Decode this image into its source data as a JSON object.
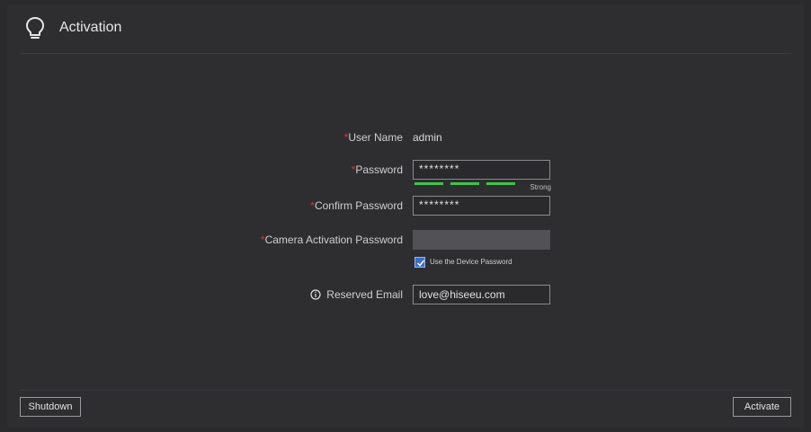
{
  "header": {
    "title": "Activation",
    "icon": "lightbulb-icon"
  },
  "form": {
    "user_name": {
      "label": "User Name",
      "required_marker": "*",
      "value": "admin"
    },
    "password": {
      "label": "Password",
      "required_marker": "*",
      "value": "********",
      "strength_label": "Strong",
      "strength_color": "#3fc24a",
      "strength_level": 3,
      "strength_max": 3
    },
    "confirm_password": {
      "label": "Confirm Password",
      "required_marker": "*",
      "value": "********"
    },
    "camera_activation_password": {
      "label": "Camera Activation Password",
      "required_marker": "*",
      "value": ""
    },
    "use_device_password": {
      "label": "Use the Device Password",
      "checked": true
    },
    "reserved_email": {
      "label": "Reserved Email",
      "icon": "info-icon",
      "value": "love@hiseeu.com"
    }
  },
  "footer": {
    "shutdown_label": "Shutdown",
    "activate_label": "Activate"
  },
  "colors": {
    "background": "#2e2e31",
    "required": "#d23b3b",
    "checkbox": "#3a6fc8"
  }
}
